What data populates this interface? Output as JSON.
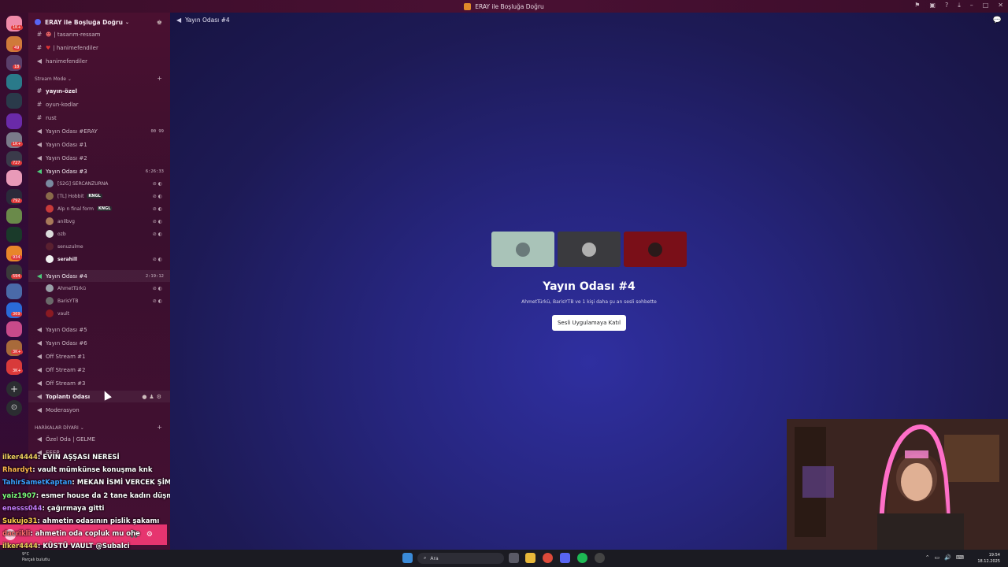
{
  "window": {
    "title": "ERAY ile Boşluğa Doğru"
  },
  "server": {
    "name": "ERAY ile Boşluğa Doğru"
  },
  "rail_badges": [
    "1K+",
    "49",
    "18",
    "1K+",
    "727",
    "792",
    "934",
    "594",
    "369",
    "3K+",
    "3K+"
  ],
  "top_channels": [
    {
      "label": "| tasarım-ressam"
    },
    {
      "label": "| hanimefendiler"
    },
    {
      "label": "hanimefendiler"
    }
  ],
  "category_stream": "Stream Mode",
  "channels": [
    {
      "label": "yayın-özel",
      "type": "text",
      "bold": true
    },
    {
      "label": "oyun-kodlar",
      "type": "text"
    },
    {
      "label": "rust",
      "type": "text"
    },
    {
      "label": "Yayın Odası #ERAY",
      "type": "voice",
      "limit": "00 99"
    },
    {
      "label": "Yayın Odası #1",
      "type": "voice"
    },
    {
      "label": "Yayın Odası #2",
      "type": "voice"
    },
    {
      "label": "Yayın Odası #3",
      "type": "voice",
      "timer": "6:26:33"
    }
  ],
  "room3_users": [
    {
      "name": "[S2G] SERCANZURNA"
    },
    {
      "name": "[TL] Hobbit",
      "tag": "KNGL"
    },
    {
      "name": "Alp n final form",
      "tag": "KNGL"
    },
    {
      "name": "anilbvg"
    },
    {
      "name": "ozb"
    },
    {
      "name": "senuzulme"
    },
    {
      "name": "serahill"
    }
  ],
  "room4": {
    "label": "Yayın Odası #4",
    "timer": "2:19:12"
  },
  "room4_users": [
    {
      "name": "AhmetTürkü"
    },
    {
      "name": "BarisYTB"
    },
    {
      "name": "vault"
    }
  ],
  "channels_after": [
    {
      "label": "Yayın Odası #5"
    },
    {
      "label": "Yayın Odası #6"
    },
    {
      "label": "Off Stream #1"
    },
    {
      "label": "Off Stream #2"
    },
    {
      "label": "Off Stream #3"
    },
    {
      "label": "Toplantı Odası"
    },
    {
      "label": "Moderasyon"
    }
  ],
  "category_harika": "HARİKALAR DİYARI",
  "harika_channels": [
    {
      "label": "Özel Oda | GELME"
    },
    {
      "label": "EEEP"
    }
  ],
  "chat": [
    {
      "user": "ilker4444",
      "msg": ": EVIN AŞŞASI NERESİ",
      "color": "#f0d060"
    },
    {
      "user": "Rhardyt",
      "msg": ": vault mümkünse konuşma knk",
      "color": "#ffb84d"
    },
    {
      "user": "TahirSametKaptan",
      "msg": ": MEKAN İSMİ VERCEK ŞİMDİ",
      "color": "#3aa0ff"
    },
    {
      "user": "yaiz1907",
      "msg": ": esmer house da 2 tane kadın düşmanı var",
      "color": "#7dff7d"
    },
    {
      "user": "enesss044",
      "msg": ": çağırmaya gitti",
      "color": "#c87dff"
    },
    {
      "user": "Sukujo31",
      "msg": ": ahmetin odasının pislik şakamı",
      "color": "#ffd24d"
    },
    {
      "user": "dacrikli",
      "msg": ": ahmetin oda copluk mu ohe",
      "color": "#ff6f6f"
    },
    {
      "user": "ilker4444",
      "msg": ": KÜSTÜ VAULT @Subalci",
      "color": "#f0d060"
    }
  ],
  "main": {
    "channel_title": "Yayın Odası #4",
    "vc_title": "Yayın Odası #4",
    "vc_subtitle": "AhmetTürkü, BarisYTB ve 1 kişi daha şu an sesli sohbette",
    "join_label": "Sesli Uygulamaya Katıl"
  },
  "taskbar": {
    "weather_temp": "9°C",
    "weather_desc": "Parçalı bulutlu",
    "search_placeholder": "Ara",
    "time": "19:54",
    "date": "18.12.2025"
  },
  "colors": {
    "join_bg": "#ffffff",
    "panel_pink": "#e6356f",
    "accent": "#5865f2"
  }
}
